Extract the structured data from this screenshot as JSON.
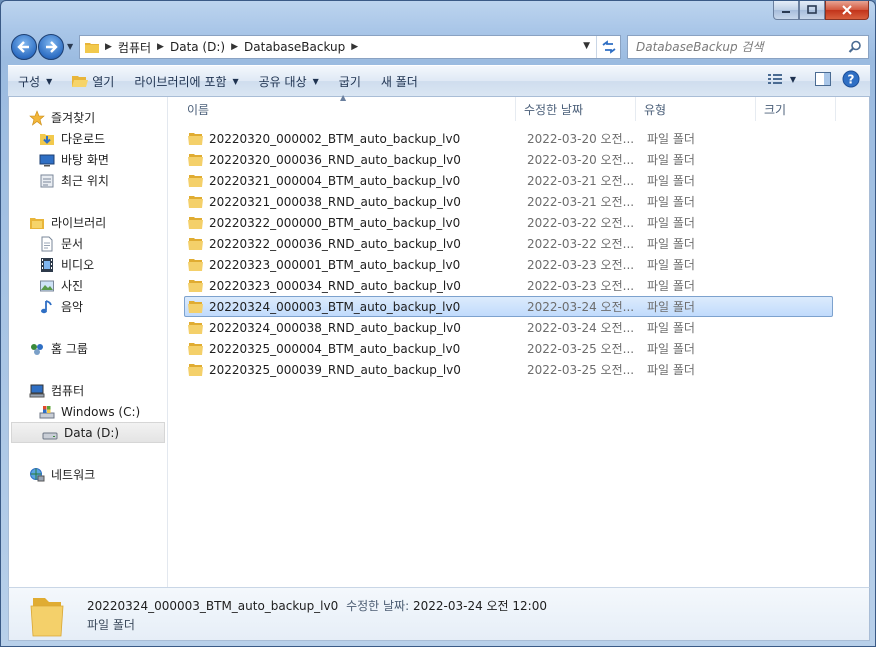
{
  "address": {
    "crumbs": [
      "컴퓨터",
      "Data (D:)",
      "DatabaseBackup"
    ]
  },
  "search": {
    "placeholder": "DatabaseBackup 검색"
  },
  "toolbar": {
    "organize": "구성",
    "open": "열기",
    "include_library": "라이브러리에 포함",
    "share": "공유 대상",
    "burn": "굽기",
    "new_folder": "새 폴더"
  },
  "navpane": {
    "favorites": "즐겨찾기",
    "downloads": "다운로드",
    "desktop": "바탕 화면",
    "recent": "최근 위치",
    "libraries": "라이브러리",
    "documents": "문서",
    "videos": "비디오",
    "pictures": "사진",
    "music": "음악",
    "homegroup": "홈 그룹",
    "computer": "컴퓨터",
    "drive_c": "Windows (C:)",
    "drive_d": "Data (D:)",
    "network": "네트워크"
  },
  "columns": {
    "name": "이름",
    "date": "수정한 날짜",
    "type": "유형",
    "size": "크기"
  },
  "files": [
    {
      "name": "20220320_000002_BTM_auto_backup_lv0",
      "date": "2022-03-20 오전...",
      "type": "파일 폴더"
    },
    {
      "name": "20220320_000036_RND_auto_backup_lv0",
      "date": "2022-03-20 오전...",
      "type": "파일 폴더"
    },
    {
      "name": "20220321_000004_BTM_auto_backup_lv0",
      "date": "2022-03-21 오전...",
      "type": "파일 폴더"
    },
    {
      "name": "20220321_000038_RND_auto_backup_lv0",
      "date": "2022-03-21 오전...",
      "type": "파일 폴더"
    },
    {
      "name": "20220322_000000_BTM_auto_backup_lv0",
      "date": "2022-03-22 오전...",
      "type": "파일 폴더"
    },
    {
      "name": "20220322_000036_RND_auto_backup_lv0",
      "date": "2022-03-22 오전...",
      "type": "파일 폴더"
    },
    {
      "name": "20220323_000001_BTM_auto_backup_lv0",
      "date": "2022-03-23 오전...",
      "type": "파일 폴더"
    },
    {
      "name": "20220323_000034_RND_auto_backup_lv0",
      "date": "2022-03-23 오전...",
      "type": "파일 폴더"
    },
    {
      "name": "20220324_000003_BTM_auto_backup_lv0",
      "date": "2022-03-24 오전...",
      "type": "파일 폴더"
    },
    {
      "name": "20220324_000038_RND_auto_backup_lv0",
      "date": "2022-03-24 오전...",
      "type": "파일 폴더"
    },
    {
      "name": "20220325_000004_BTM_auto_backup_lv0",
      "date": "2022-03-25 오전...",
      "type": "파일 폴더"
    },
    {
      "name": "20220325_000039_RND_auto_backup_lv0",
      "date": "2022-03-25 오전...",
      "type": "파일 폴더"
    }
  ],
  "selected_index": 8,
  "details": {
    "name": "20220324_000003_BTM_auto_backup_lv0",
    "modified_label": "수정한 날짜:",
    "modified_value": "2022-03-24 오전 12:00",
    "type": "파일 폴더"
  },
  "colors": {
    "folder": "#f2c94c",
    "selection": "#c1dbfc",
    "accent": "#2f6fc4"
  }
}
